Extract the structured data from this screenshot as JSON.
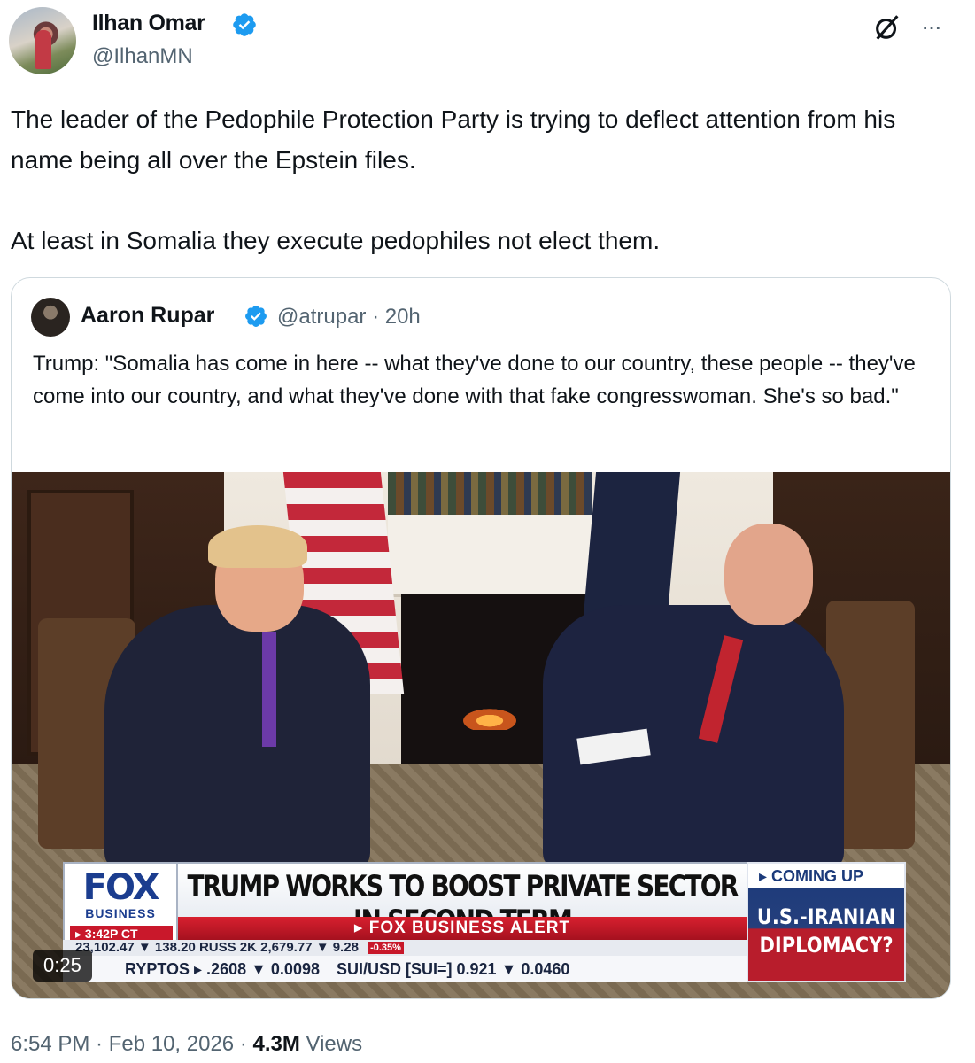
{
  "author": {
    "name": "Ilhan Omar",
    "handle": "@IlhanMN",
    "verified": true
  },
  "tweet": {
    "paragraph_1": "The leader of the Pedophile Protection Party is trying to deflect attention from his name being all over the Epstein files.",
    "paragraph_2": "At least in Somalia they execute pedophiles not elect them."
  },
  "icons": {
    "grok": "grok-icon",
    "more": "···"
  },
  "quoted": {
    "name": "Aaron Rupar",
    "handle": "@atrupar",
    "age": "20h",
    "meta": "@atrupar · 20h",
    "text": "Trump: \"Somalia has come in here -- what they've done to our country, these people -- they've come into our country, and what they've done with that fake congresswoman. She's so bad.\"",
    "video": {
      "duration": "0:25",
      "network_logo": "FOX",
      "network_sub": "BUSINESS",
      "clock": "▸ 3:42P CT",
      "headline": "TRUMP WORKS TO BOOST PRIVATE SECTOR IN SECOND TERM",
      "alert": "▸ FOX BUSINESS ALERT",
      "ticker_top": "23,102.47 ▼ 138.20  RUSS 2K   2,679.77 ▼ 9.28",
      "ticker_bottom_left": "RYPTOS  ▸ .2608 ▼ 0.0098",
      "ticker_bottom_right": "SUI/USD [SUI=]  0.921 ▼ 0.0460",
      "ticker_badge": "-0.35%",
      "coming_up_label": "▸ COMING UP",
      "coming_up_text": "U.S.-IRANIAN DIPLOMACY?"
    }
  },
  "footer": {
    "timestamp": "6:54 PM · Feb 10, 2026 · ",
    "views_count": "4.3M",
    "views_label": " Views"
  },
  "colors": {
    "verified_blue": "#1d9bf0",
    "text_primary": "#0f1419",
    "text_secondary": "#536471",
    "border": "#cfd9de"
  }
}
